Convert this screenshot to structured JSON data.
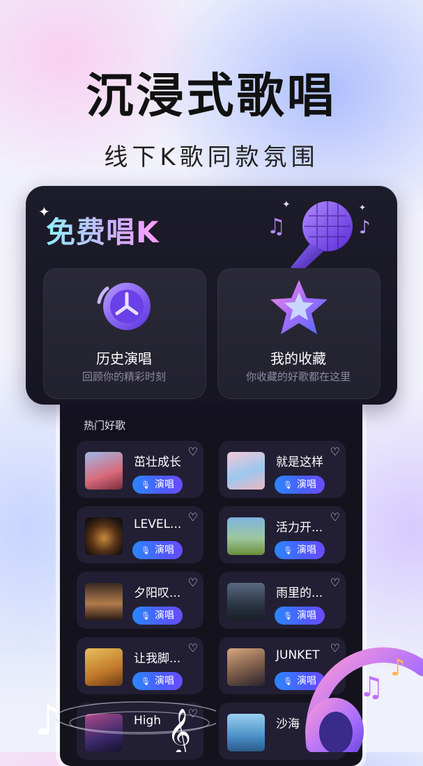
{
  "headline": "沉浸式歌唱",
  "subline": "线下K歌同款氛围",
  "free_k": {
    "title": "免费唱K",
    "tiles": [
      {
        "title": "历史演唱",
        "subtitle": "回顾你的精彩时刻",
        "icon": "history-clock-icon"
      },
      {
        "title": "我的收藏",
        "subtitle": "你收藏的好歌都在这里",
        "icon": "star-icon"
      }
    ]
  },
  "section_title": "热门好歌",
  "sing_label": "演唱",
  "songs": [
    {
      "name": "茁壮成长"
    },
    {
      "name": "就是这样"
    },
    {
      "name": "LEVEL..."
    },
    {
      "name": "活力开..."
    },
    {
      "name": "夕阳叹..."
    },
    {
      "name": "雨里的..."
    },
    {
      "name": "让我脚..."
    },
    {
      "name": "JUNKET"
    },
    {
      "name": "High"
    },
    {
      "name": "沙海"
    }
  ],
  "colors": {
    "accent": "#4d5cff",
    "card_bg": "#1d1c2a",
    "song_bg": "#221f34"
  }
}
